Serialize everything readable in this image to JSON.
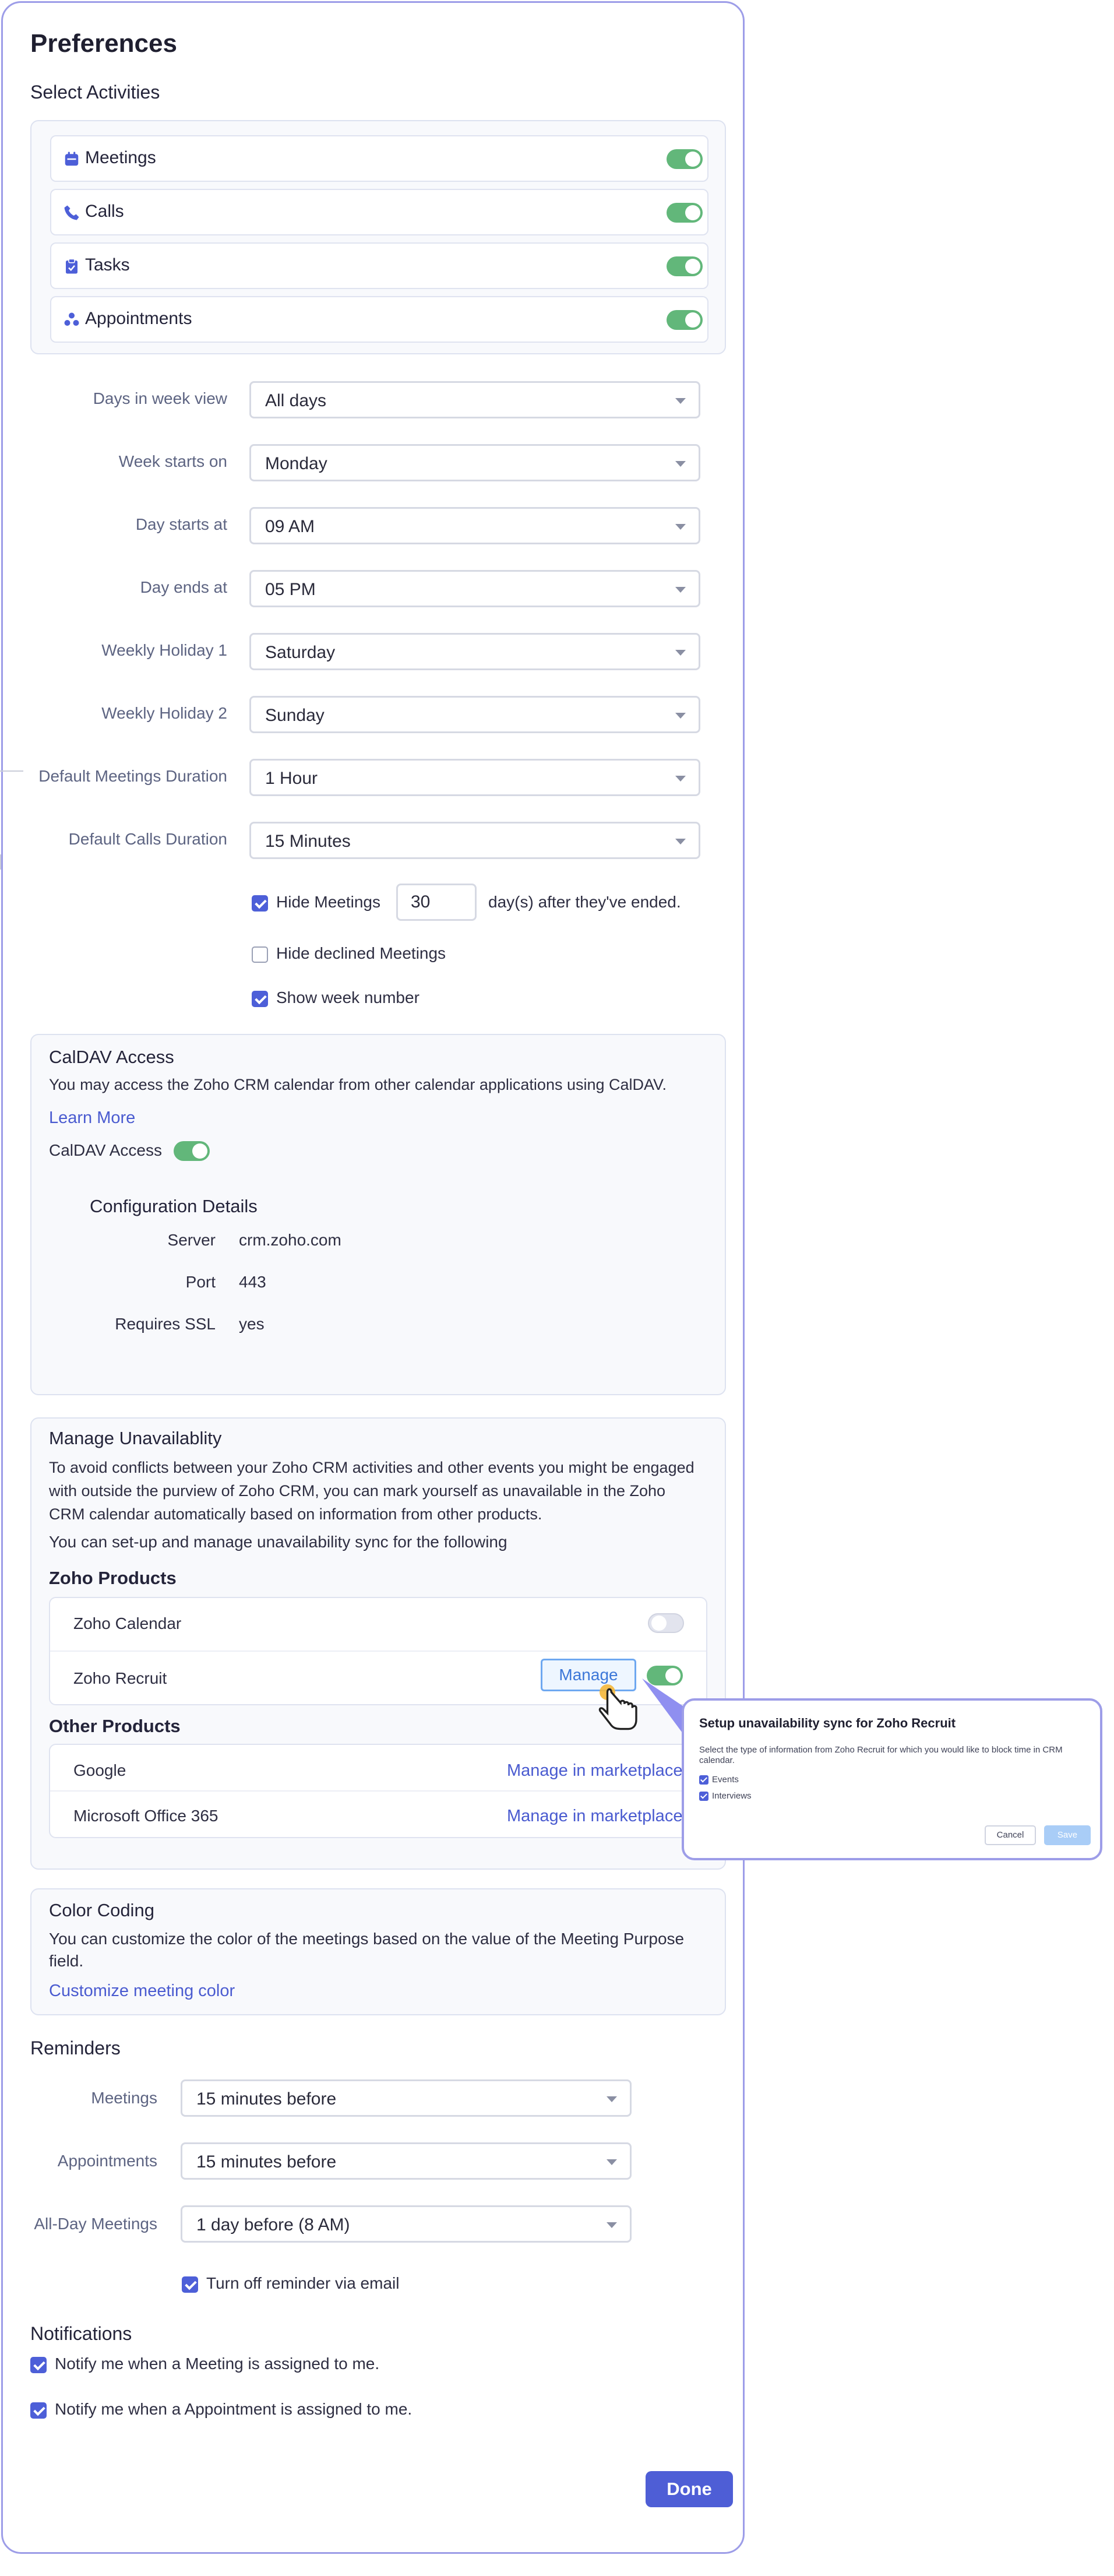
{
  "header": {
    "title": "Preferences"
  },
  "activities": {
    "heading": "Select Activities",
    "items": [
      {
        "label": "Meetings",
        "icon": "calendar-icon",
        "enabled": true
      },
      {
        "label": "Calls",
        "icon": "phone-icon",
        "enabled": true
      },
      {
        "label": "Tasks",
        "icon": "clipboard-icon",
        "enabled": true
      },
      {
        "label": "Appointments",
        "icon": "people-icon",
        "enabled": true
      }
    ]
  },
  "settings": [
    {
      "label": "Days in week view",
      "value": "All days"
    },
    {
      "label": "Week starts on",
      "value": "Monday"
    },
    {
      "label": "Day starts at",
      "value": "09 AM"
    },
    {
      "label": "Day ends at",
      "value": "05 PM"
    },
    {
      "label": "Weekly Holiday 1",
      "value": "Saturday"
    },
    {
      "label": "Weekly Holiday 2",
      "value": "Sunday"
    },
    {
      "label": "Default Meetings Duration",
      "value": "1 Hour"
    },
    {
      "label": "Default Calls Duration",
      "value": "15 Minutes"
    }
  ],
  "options": {
    "hide_meetings_label": "Hide Meetings",
    "hide_meetings_days": "30",
    "hide_meetings_suffix": "day(s) after they've ended.",
    "hide_declined_label": "Hide declined Meetings",
    "show_week_number_label": "Show week number"
  },
  "caldav": {
    "title": "CalDAV Access",
    "description": "You may access the Zoho CRM calendar from other calendar applications using CalDAV.",
    "learn_more": "Learn More",
    "toggle_label": "CalDAV Access",
    "config_title": "Configuration Details",
    "rows": [
      {
        "label": "Server",
        "value": "crm.zoho.com"
      },
      {
        "label": "Port",
        "value": "443"
      },
      {
        "label": "Requires SSL",
        "value": "yes"
      }
    ]
  },
  "unavailability": {
    "title": "Manage Unavailablity",
    "description": "To avoid conflicts between your Zoho CRM activities and other events you might be engaged with outside the purview of Zoho CRM, you can mark yourself as unavailable in the Zoho CRM calendar automatically based on information from other products.",
    "setup_text": "You can set-up and manage unavailability sync for the following",
    "zoho_heading": "Zoho Products",
    "zoho_products": [
      {
        "name": "Zoho Calendar",
        "enabled": false
      },
      {
        "name": "Zoho Recruit",
        "enabled": true,
        "action": "Manage"
      }
    ],
    "other_heading": "Other Products",
    "other_products": [
      {
        "name": "Google",
        "action": "Manage in marketplace"
      },
      {
        "name": "Microsoft Office 365",
        "action": "Manage in marketplace"
      }
    ]
  },
  "color_coding": {
    "title": "Color Coding",
    "description": "You can customize the color of the meetings based on the value of the Meeting Purpose field.",
    "link": "Customize meeting color"
  },
  "reminders": {
    "heading": "Reminders",
    "rows": [
      {
        "label": "Meetings",
        "value": "15 minutes before"
      },
      {
        "label": "Appointments",
        "value": "15 minutes before"
      },
      {
        "label": "All-Day Meetings",
        "value": "1 day before (8 AM)"
      }
    ],
    "email_off_label": "Turn off reminder via email"
  },
  "notifications": {
    "heading": "Notifications",
    "items": [
      "Notify me when a Meeting is assigned to me.",
      "Notify me when a Appointment is assigned to me."
    ]
  },
  "done_label": "Done",
  "popover": {
    "title": "Setup unavailability sync for Zoho Recruit",
    "description": "Select the type of information from Zoho Recruit for which you would like to block time in CRM calendar.",
    "options": [
      "Events",
      "Interviews"
    ],
    "cancel": "Cancel",
    "save": "Save"
  },
  "colors": {
    "accent": "#4e5ed6",
    "toggle_on": "#62b77a",
    "link": "#4a5bd0"
  }
}
